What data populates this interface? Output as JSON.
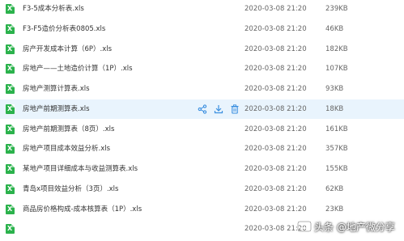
{
  "files": [
    {
      "name": "F3-5成本分析表.xls",
      "date": "2020-03-08 21:20",
      "size": "239KB"
    },
    {
      "name": "F3-F5造价分析表0805.xls",
      "date": "2020-03-08 21:20",
      "size": "46KB"
    },
    {
      "name": "房产开发成本计算（6P）.xls",
      "date": "2020-03-08 21:20",
      "size": "182KB"
    },
    {
      "name": "房地产——土地造价计算（1P）.xls",
      "date": "2020-03-08 21:20",
      "size": "107KB"
    },
    {
      "name": "房地产测算计算表.xls",
      "date": "2020-03-08 21:20",
      "size": "93KB"
    },
    {
      "name": "房地产前期测算表.xls",
      "date": "2020-03-08 21:20",
      "size": "18KB"
    },
    {
      "name": "房地产前期测算表（8页）.xls",
      "date": "2020-03-08 21:20",
      "size": "161KB"
    },
    {
      "name": "房地产项目成本效益分析.xls",
      "date": "2020-03-08 21:20",
      "size": "357KB"
    },
    {
      "name": "某地产项目详细成本与收益测算表.xls",
      "date": "2020-03-08 21:20",
      "size": "155KB"
    },
    {
      "name": "青岛x项目效益分析（3页）.xls",
      "date": "2020-03-08 21:20",
      "size": "62KB"
    },
    {
      "name": "商品房价格构成-成本核算表（1P）.xls",
      "date": "2020-03-08 21:20",
      "size": "23KB"
    },
    {
      "name": "",
      "date": "2020-03-08 21:20",
      "size": ""
    }
  ],
  "file_icon_letter": "X",
  "highlighted_row": 5,
  "row_actions": [
    "share-icon",
    "download-icon",
    "delete-icon"
  ],
  "colors": {
    "highlight": "#e9f4fd",
    "xls_green": "#2bb24c",
    "action_blue": "#3b8fe0"
  },
  "watermark": {
    "text": "头条 @地产微分享",
    "icon": "toutiao-logo-icon"
  }
}
